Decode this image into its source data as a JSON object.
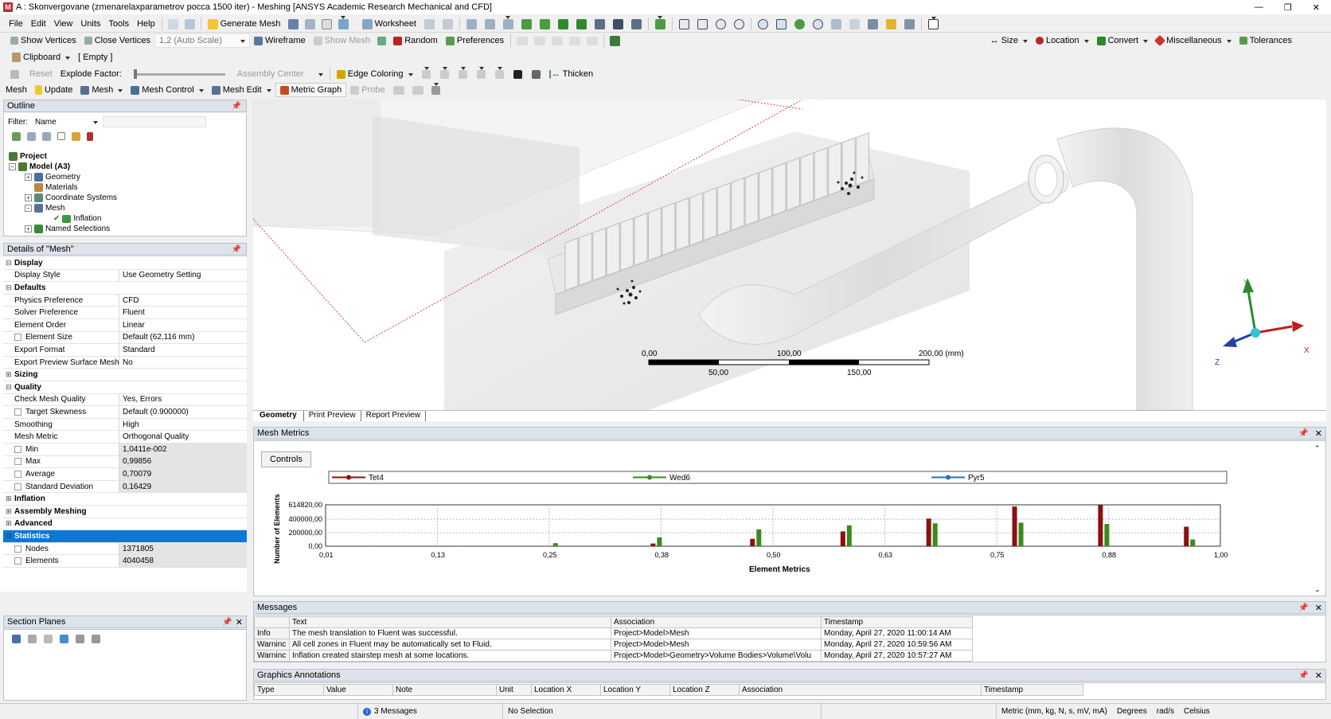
{
  "window": {
    "title": "A : Skonvergovane (zmenarelaxparametrov pocca 1500 iter) - Meshing [ANSYS Academic Research Mechanical and CFD]",
    "min": "—",
    "max": "❐",
    "close": "✕"
  },
  "menu": [
    "File",
    "Edit",
    "View",
    "Units",
    "Tools",
    "Help"
  ],
  "toolbar1": {
    "generate": "Generate Mesh",
    "worksheet": "Worksheet"
  },
  "toolbar2": {
    "show_vertices": "Show Vertices",
    "close_vertices": "Close Vertices",
    "scale": "1,2 (Auto Scale)",
    "wireframe": "Wireframe",
    "show_mesh": "Show Mesh",
    "random": "Random",
    "preferences": "Preferences",
    "size": "Size",
    "location": "Location",
    "convert": "Convert",
    "misc": "Miscellaneous",
    "tolerances": "Tolerances"
  },
  "toolbar3": {
    "clipboard": "Clipboard",
    "clipboard_value": "[ Empty ]"
  },
  "toolbar4": {
    "reset": "Reset",
    "explode": "Explode Factor:",
    "assembly_center": "Assembly Center",
    "edge_coloring": "Edge Coloring",
    "thicken": "Thicken"
  },
  "toolbar5": {
    "mesh": "Mesh",
    "update": "Update",
    "mesh_dd": "Mesh",
    "mesh_control": "Mesh Control",
    "mesh_edit": "Mesh Edit",
    "metric_graph": "Metric Graph",
    "probe": "Probe"
  },
  "outline": {
    "title": "Outline",
    "filter_label": "Filter:",
    "filter_value": "Name",
    "tree": [
      {
        "label": "Project",
        "bold": true
      },
      {
        "label": "Model (A3)",
        "bold": true
      },
      {
        "label": "Geometry"
      },
      {
        "label": "Materials"
      },
      {
        "label": "Coordinate Systems"
      },
      {
        "label": "Mesh"
      },
      {
        "label": "Inflation"
      },
      {
        "label": "Named Selections"
      }
    ]
  },
  "details": {
    "title": "Details of \"Mesh\"",
    "rows": [
      {
        "k": "Display",
        "sec": true,
        "sign": "−"
      },
      {
        "k": "Display Style",
        "v": "Use Geometry Setting"
      },
      {
        "k": "Defaults",
        "sec": true,
        "sign": "−"
      },
      {
        "k": "Physics Preference",
        "v": "CFD"
      },
      {
        "k": "Solver Preference",
        "v": "Fluent"
      },
      {
        "k": "Element Order",
        "v": "Linear"
      },
      {
        "k": "Element Size",
        "v": "Default (62,116 mm)",
        "cb": true
      },
      {
        "k": "Export Format",
        "v": "Standard"
      },
      {
        "k": "Export Preview Surface Mesh",
        "v": "No"
      },
      {
        "k": "Sizing",
        "sec": true,
        "sign": "+"
      },
      {
        "k": "Quality",
        "sec": true,
        "sign": "−"
      },
      {
        "k": "Check Mesh Quality",
        "v": "Yes, Errors"
      },
      {
        "k": "Target Skewness",
        "v": "Default (0.900000)",
        "cb": true
      },
      {
        "k": "Smoothing",
        "v": "High"
      },
      {
        "k": "Mesh Metric",
        "v": "Orthogonal Quality"
      },
      {
        "k": "Min",
        "v": "1,0411e-002",
        "cb": true,
        "gr": true
      },
      {
        "k": "Max",
        "v": "0,99856",
        "cb": true,
        "gr": true
      },
      {
        "k": "Average",
        "v": "0,70079",
        "cb": true,
        "gr": true
      },
      {
        "k": "Standard Deviation",
        "v": "0,16429",
        "cb": true,
        "gr": true
      },
      {
        "k": "Inflation",
        "sec": true,
        "sign": "+"
      },
      {
        "k": "Assembly Meshing",
        "sec": true,
        "sign": "+"
      },
      {
        "k": "Advanced",
        "sec": true,
        "sign": "+"
      },
      {
        "k": "Statistics",
        "sec": true,
        "sign": "−",
        "sel": true
      },
      {
        "k": "Nodes",
        "v": "1371805",
        "cb": true,
        "gr": true
      },
      {
        "k": "Elements",
        "v": "4040458",
        "cb": true,
        "gr": true
      }
    ]
  },
  "section_planes": {
    "title": "Section Planes"
  },
  "viewport": {
    "scale_labels_top": [
      "0,00",
      "100,00",
      "200,00 (mm)"
    ],
    "scale_labels_bottom": [
      "50,00",
      "150,00"
    ],
    "axis_x": "X",
    "axis_y": "Y",
    "axis_z": "Z"
  },
  "view_tabs": [
    "Geometry",
    "Print Preview",
    "Report Preview"
  ],
  "mesh_metrics": {
    "title": "Mesh Metrics",
    "controls": "Controls"
  },
  "chart_data": {
    "type": "bar",
    "xlabel": "Element Metrics",
    "ylabel": "Number of Elements",
    "xlim": [
      0.01,
      1.0
    ],
    "x_ticks": [
      "0,01",
      "0,13",
      "0,25",
      "0,38",
      "0,50",
      "0,63",
      "0,75",
      "0,88",
      "1,00"
    ],
    "y_ticks": [
      "614820,00",
      "400000,00",
      "200000,00",
      "0,00"
    ],
    "ylim": [
      0,
      614820
    ],
    "legend": [
      "Tet4",
      "Wed6",
      "Pyr5"
    ],
    "series": [
      {
        "name": "Tet4",
        "color": "#8b1010",
        "x": [
          0.06,
          0.155,
          0.26,
          0.375,
          0.485,
          0.585,
          0.68,
          0.775,
          0.87,
          0.965
        ],
        "values": [
          1500,
          3000,
          6000,
          40000,
          110000,
          220000,
          410000,
          590000,
          610000,
          290000
        ]
      },
      {
        "name": "Wed6",
        "color": "#3a8a1e",
        "x": [
          0.06,
          0.155,
          0.26,
          0.375,
          0.485,
          0.585,
          0.68,
          0.775,
          0.87,
          0.965
        ],
        "values": [
          1000,
          2000,
          45000,
          130000,
          250000,
          310000,
          340000,
          350000,
          330000,
          100000
        ]
      },
      {
        "name": "Pyr5",
        "color": "#2a6fb8",
        "x": [
          0.06,
          0.155,
          0.26,
          0.375,
          0.485,
          0.585,
          0.68,
          0.775,
          0.87,
          0.965
        ],
        "values": [
          0,
          0,
          0,
          0,
          0,
          0,
          0,
          0,
          0,
          0
        ]
      }
    ]
  },
  "messages": {
    "title": "Messages",
    "columns": [
      "Text",
      "Association",
      "Timestamp"
    ],
    "rows": [
      {
        "type": "Info",
        "text": "The mesh translation to Fluent was successful.",
        "assoc": "Project>Model>Mesh",
        "time": "Monday, April 27, 2020 11:00:14 AM"
      },
      {
        "type": "Warninc",
        "text": "All cell zones in Fluent may be automatically set to Fluid.",
        "assoc": "Project>Model>Mesh",
        "time": "Monday, April 27, 2020 10:59:56 AM"
      },
      {
        "type": "Warninc",
        "text": "Inflation created stairstep mesh at some locations.",
        "assoc": "Project>Model>Geometry>Volume Bodies>Volume\\Volu",
        "time": "Monday, April 27, 2020 10:57:27 AM"
      }
    ]
  },
  "annotations": {
    "title": "Graphics Annotations",
    "columns": [
      "Type",
      "Value",
      "Note",
      "Unit",
      "Location X",
      "Location Y",
      "Location Z",
      "Association",
      "Timestamp"
    ]
  },
  "status": {
    "messages": "3 Messages",
    "selection": "No Selection",
    "units": "Metric (mm, kg, N, s, mV, mA)",
    "angle": "Degrees",
    "rot": "rad/s",
    "temp": "Celsius"
  },
  "colors": {
    "accent": "#0a78d7",
    "tet": "#8b1010",
    "wed": "#3a8a1e",
    "pyr": "#2a6fb8"
  }
}
